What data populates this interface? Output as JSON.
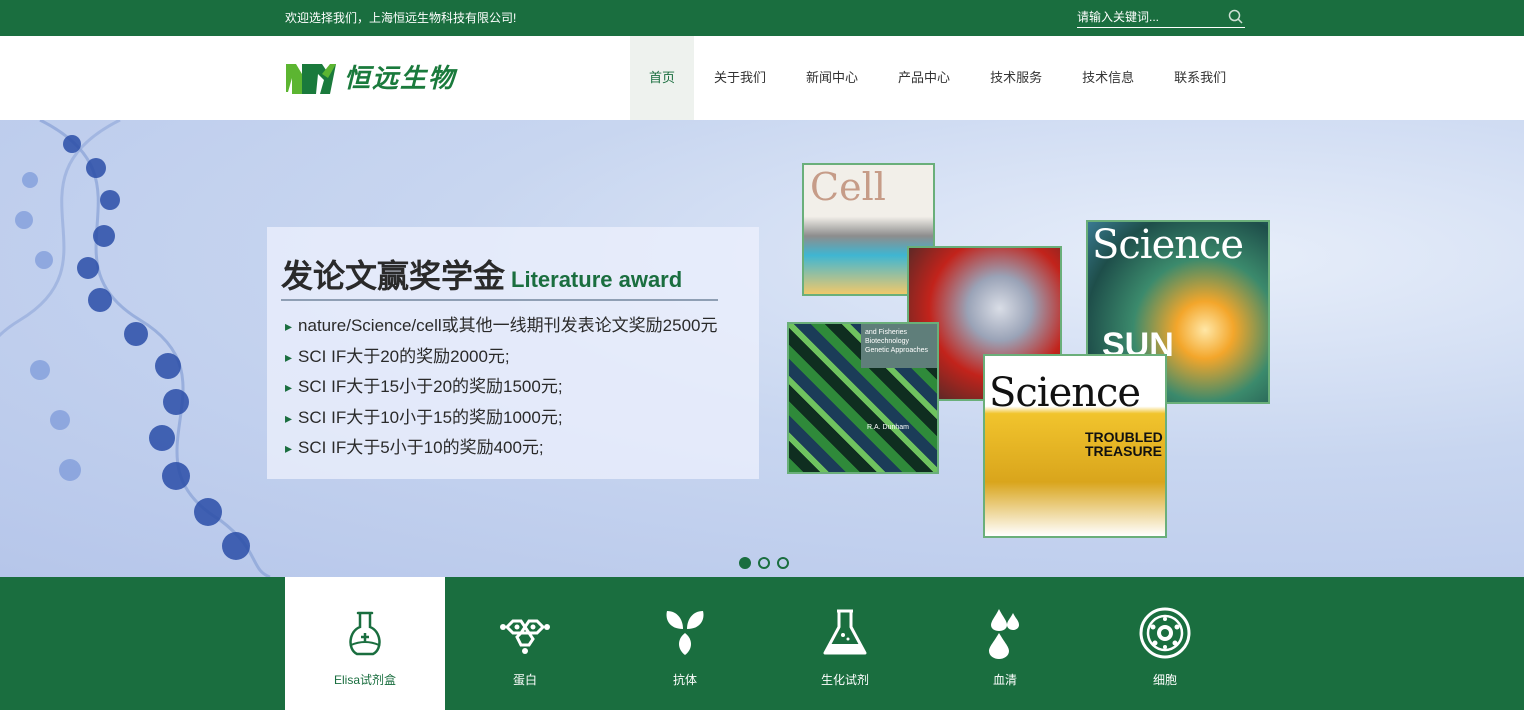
{
  "topbar": {
    "welcome": "欢迎选择我们，上海恒远生物科技有限公司!",
    "search_placeholder": "请输入关键词..."
  },
  "header": {
    "logo_text": "恒远生物",
    "nav": [
      {
        "label": "首页",
        "active": true
      },
      {
        "label": "关于我们"
      },
      {
        "label": "新闻中心"
      },
      {
        "label": "产品中心"
      },
      {
        "label": "技术服务"
      },
      {
        "label": "技术信息"
      },
      {
        "label": "联系我们"
      }
    ]
  },
  "banner": {
    "title": "发论文赢奖学金",
    "subtitle": "Literature award",
    "items": [
      "nature/Science/cell或其他一线期刊发表论文奖励2500元",
      "SCI IF大于20的奖励2000元;",
      "SCI IF大于15小于20的奖励1500元;",
      "SCI IF大于10小于15的奖励1000元;",
      "SCI IF大于5小于10的奖励400元;"
    ],
    "magazines": {
      "cell": "Cell",
      "fish_cover": "and Fisheries Biotechnology Genetic Approaches",
      "fish_author": "R.A. Dunham",
      "science_1": "Science",
      "science_1_cover": "SUN",
      "science_2": "Science",
      "science_2_cover": "TROUBLED TREASURE"
    },
    "slides": 3,
    "active_slide": 0
  },
  "categories": [
    {
      "label": "Elisa试剂盒",
      "icon": "flask-plus-icon",
      "active": true
    },
    {
      "label": "蛋白",
      "icon": "molecule-icon"
    },
    {
      "label": "抗体",
      "icon": "sprout-icon"
    },
    {
      "label": "生化试剂",
      "icon": "beaker-icon"
    },
    {
      "label": "血清",
      "icon": "droplets-icon"
    },
    {
      "label": "细胞",
      "icon": "cell-icon"
    }
  ],
  "colors": {
    "brand_green": "#1a6e3f",
    "logo_green": "#1a7a3c",
    "nav_active_bg": "#eef2ee"
  }
}
